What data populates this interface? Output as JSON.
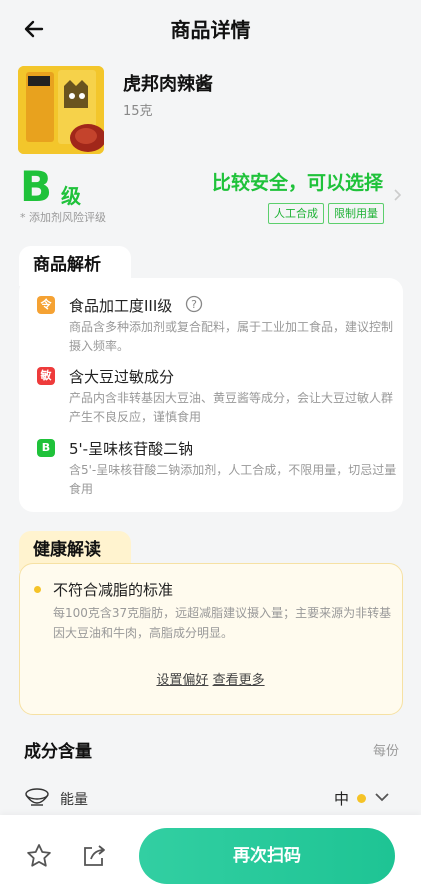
{
  "header": {
    "title": "商品详情"
  },
  "product": {
    "name": "虎邦肉辣酱",
    "weight": "15克",
    "image_label": "虎邦 辣酱"
  },
  "grade": {
    "letter": "B",
    "word": "级",
    "note": "* 添加剂风险评级",
    "verdict": "比较安全，可以选择",
    "tags": [
      "人工合成",
      "限制用量"
    ]
  },
  "analysis": {
    "title": "商品解析",
    "items": [
      {
        "icon": "令",
        "icon_color": "#f5a233",
        "title": "食品加工度III级",
        "desc": "商品含多种添加剂或复合配料，属于工业加工食品，建议控制摄入频率。"
      },
      {
        "icon": "敏",
        "icon_color": "#ee3b3b",
        "title": "含大豆过敏成分",
        "desc": "产品内含非转基因大豆油、黄豆酱等成分，会让大豆过敏人群产生不良反应，谨慎食用"
      },
      {
        "icon": "B",
        "icon_color": "#1fc23a",
        "title": "5'-呈味核苷酸二钠",
        "desc": "含5'-呈味核苷酸二钠添加剂，人工合成，不限用量，切忌过量食用"
      }
    ]
  },
  "health": {
    "title": "健康解读",
    "item_title": "不符合减脂的标准",
    "item_desc": "每100克含37克脂肪，远超减脂建议摄入量；主要来源为非转基因大豆油和牛肉，高脂成分明显。",
    "link1": "设置偏好",
    "link2": "查看更多"
  },
  "composition": {
    "title": "成分含量",
    "unit": "每份",
    "energy_label": "能量",
    "energy_level": "中"
  },
  "bottom": {
    "scan_label": "再次扫码"
  },
  "colors": {
    "green": "#1fc23a",
    "accent": "#1ec494",
    "yellow": "#f5c327"
  }
}
